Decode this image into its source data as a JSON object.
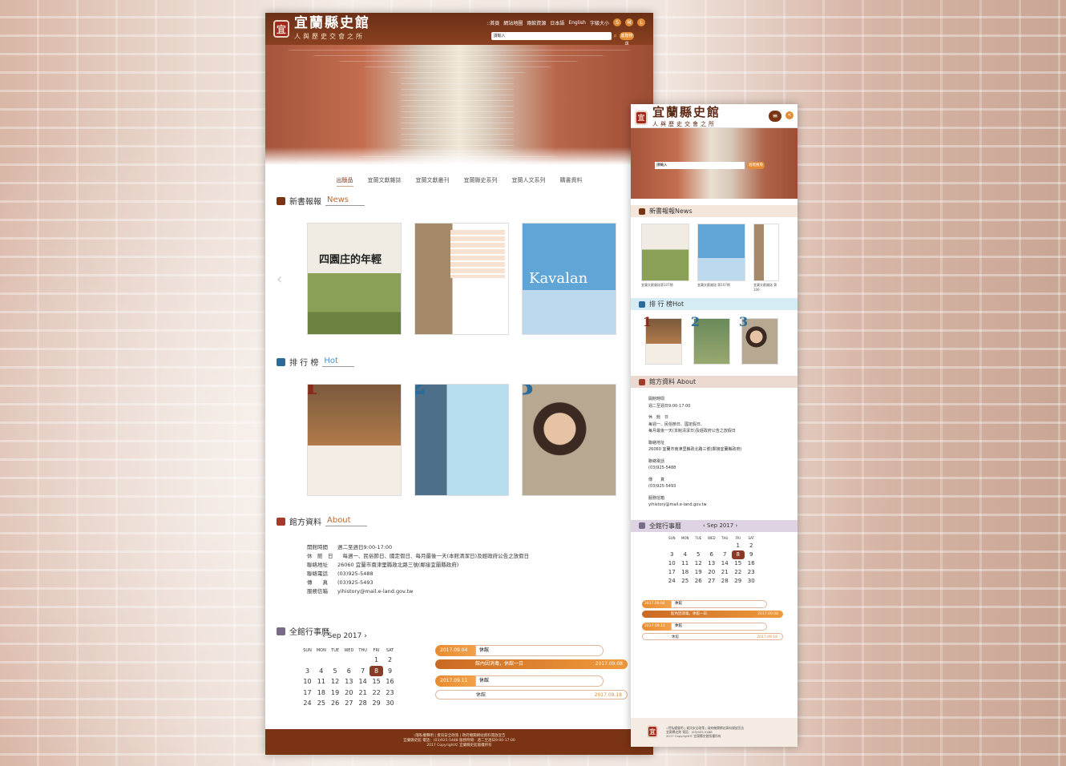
{
  "desktop": {
    "logo": {
      "seal": "宜",
      "title": "宜蘭縣史館",
      "subtitle": "人與歷史交會之所"
    },
    "topnav": [
      "::首頁",
      "網站地圖",
      "兩館資源",
      "日本語",
      "English",
      "字級大小"
    ],
    "font_sizes": [
      "S",
      "M",
      "L"
    ],
    "search": {
      "placeholder": "請輸入",
      "button": "進階搜尋"
    },
    "tabs": [
      "出版品",
      "宜蘭文獻雜誌",
      "宜蘭文獻叢刊",
      "宜蘭縣史系列",
      "宜蘭人文系列",
      "購書資料"
    ],
    "news_title": {
      "zh": "新書報報",
      "en": "News"
    },
    "hot_title": {
      "zh": "排 行 榜",
      "en": "Hot"
    },
    "about_title": {
      "zh": "館方資料",
      "en": "About"
    },
    "about_rows": [
      {
        "k": "開館時間",
        "v": "週二至週日9:00-17:00"
      },
      {
        "k": "休　館　日",
        "v": "每週一、民俗節日、國定假日、每月最後一天(本館清潔日)及經政府公告之放假日"
      },
      {
        "k": "聯絡地址",
        "v": "26060 宜蘭市南津里縣政北路三號(鄰接宜蘭縣政府)"
      },
      {
        "k": "聯絡電話",
        "v": "(03)925-5488"
      },
      {
        "k": "傳　　真",
        "v": "(03)925-5493"
      },
      {
        "k": "服務信箱",
        "v": "yihistory@mail.e-land.gov.tw"
      }
    ],
    "calendar_title": "全館行事曆",
    "calendar_month": "Sep 2017",
    "weekdays": [
      "SUN",
      "MON",
      "TUE",
      "WED",
      "THU",
      "FRI",
      "SAT"
    ],
    "events": [
      {
        "date": "2017.09.04",
        "text": "休館"
      },
      {
        "date": "2017.09.11",
        "text": "休館"
      }
    ],
    "bars": [
      {
        "text": "館內因消毒，休館一日",
        "date": "2017.09.08"
      },
      {
        "text": "休館",
        "date": "2017.09.18"
      }
    ],
    "ranks": [
      "1",
      "2",
      "3"
    ],
    "book_covers": [
      "四園庄的年輕",
      "Kavalan",
      "宜蘭文獻雜誌"
    ],
    "footer": [
      "::隱私權聲明 | 資訊安全政策 | 政府機關網站資料開放宣告",
      "宜蘭縣史館 電話：(03)925-5488 服務時間：週二至週日9:00-17:00",
      "2017 Copyright© 宜蘭縣史館版權所有"
    ]
  },
  "mobile": {
    "menu_icon": "≡",
    "share_icon": "<",
    "news": "新書報報News",
    "hot": "排 行 榜Hot",
    "about": "館方資料 About",
    "calendar": "全館行事曆",
    "month": "Sep 2017",
    "captions": [
      "宜蘭文獻雜誌第107期",
      "宜蘭文獻雜誌 第107期",
      "宜蘭文獻雜誌 第106"
    ],
    "about_lines": [
      "開館時間",
      "週二至週日9:00-17:00",
      "休　館　日",
      "每週一、民俗節日、國定假日、",
      "每月最後一天(本館清潔日)及經政府公告之放假日",
      "聯絡地址",
      "26060 宜蘭市南津里縣政北路三號(鄰接宜蘭縣政府)",
      "聯絡電話",
      "(03)925-5488",
      "傳　　真",
      "(03)925-5493",
      "服務信箱",
      "yihistory@mail.e-land.gov.tw"
    ],
    "footer": [
      "::隱私權聲明 | 資訊安全政策 | 政府機關網站資料開放宣告",
      "宜蘭縣史館 電話：(03)925-5488",
      "2017 Copyright© 宜蘭縣史館版權所有"
    ]
  },
  "colors": {
    "brand": "#7a3414",
    "accent": "#e28c37",
    "news_bar": "#f5e6dc",
    "hot_bar": "#d6ecf5",
    "cal_bar": "#ded3e2"
  }
}
